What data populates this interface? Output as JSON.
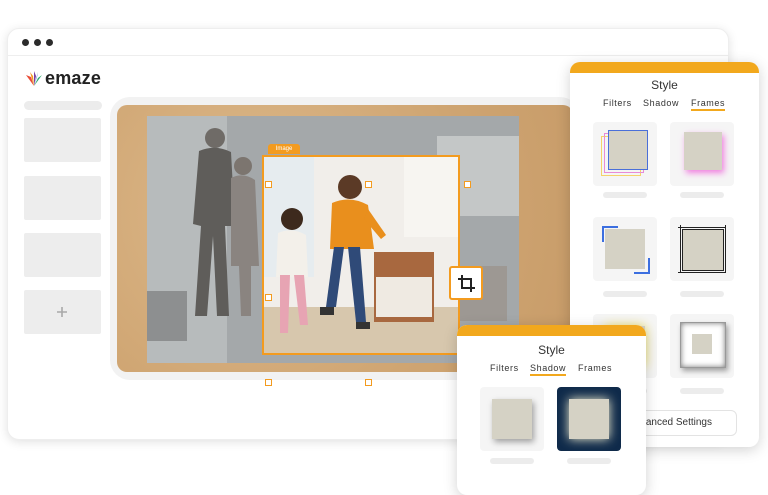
{
  "app": {
    "logo_text": "emaze"
  },
  "canvas": {
    "image_tag_label": "Image"
  },
  "style_panel_frames": {
    "title": "Style",
    "tabs": [
      "Filters",
      "Shadow",
      "Frames"
    ],
    "active_tab": "Frames",
    "advanced_button_label": "Advanced Settings"
  },
  "style_panel_shadow": {
    "title": "Style",
    "tabs": [
      "Filters",
      "Shadow",
      "Frames"
    ],
    "active_tab": "Shadow"
  },
  "colors": {
    "accent": "#f2a81d",
    "selection": "#f39b1f"
  },
  "icons": [
    "emaze-logo-icon",
    "plus-icon",
    "crop-icon"
  ]
}
